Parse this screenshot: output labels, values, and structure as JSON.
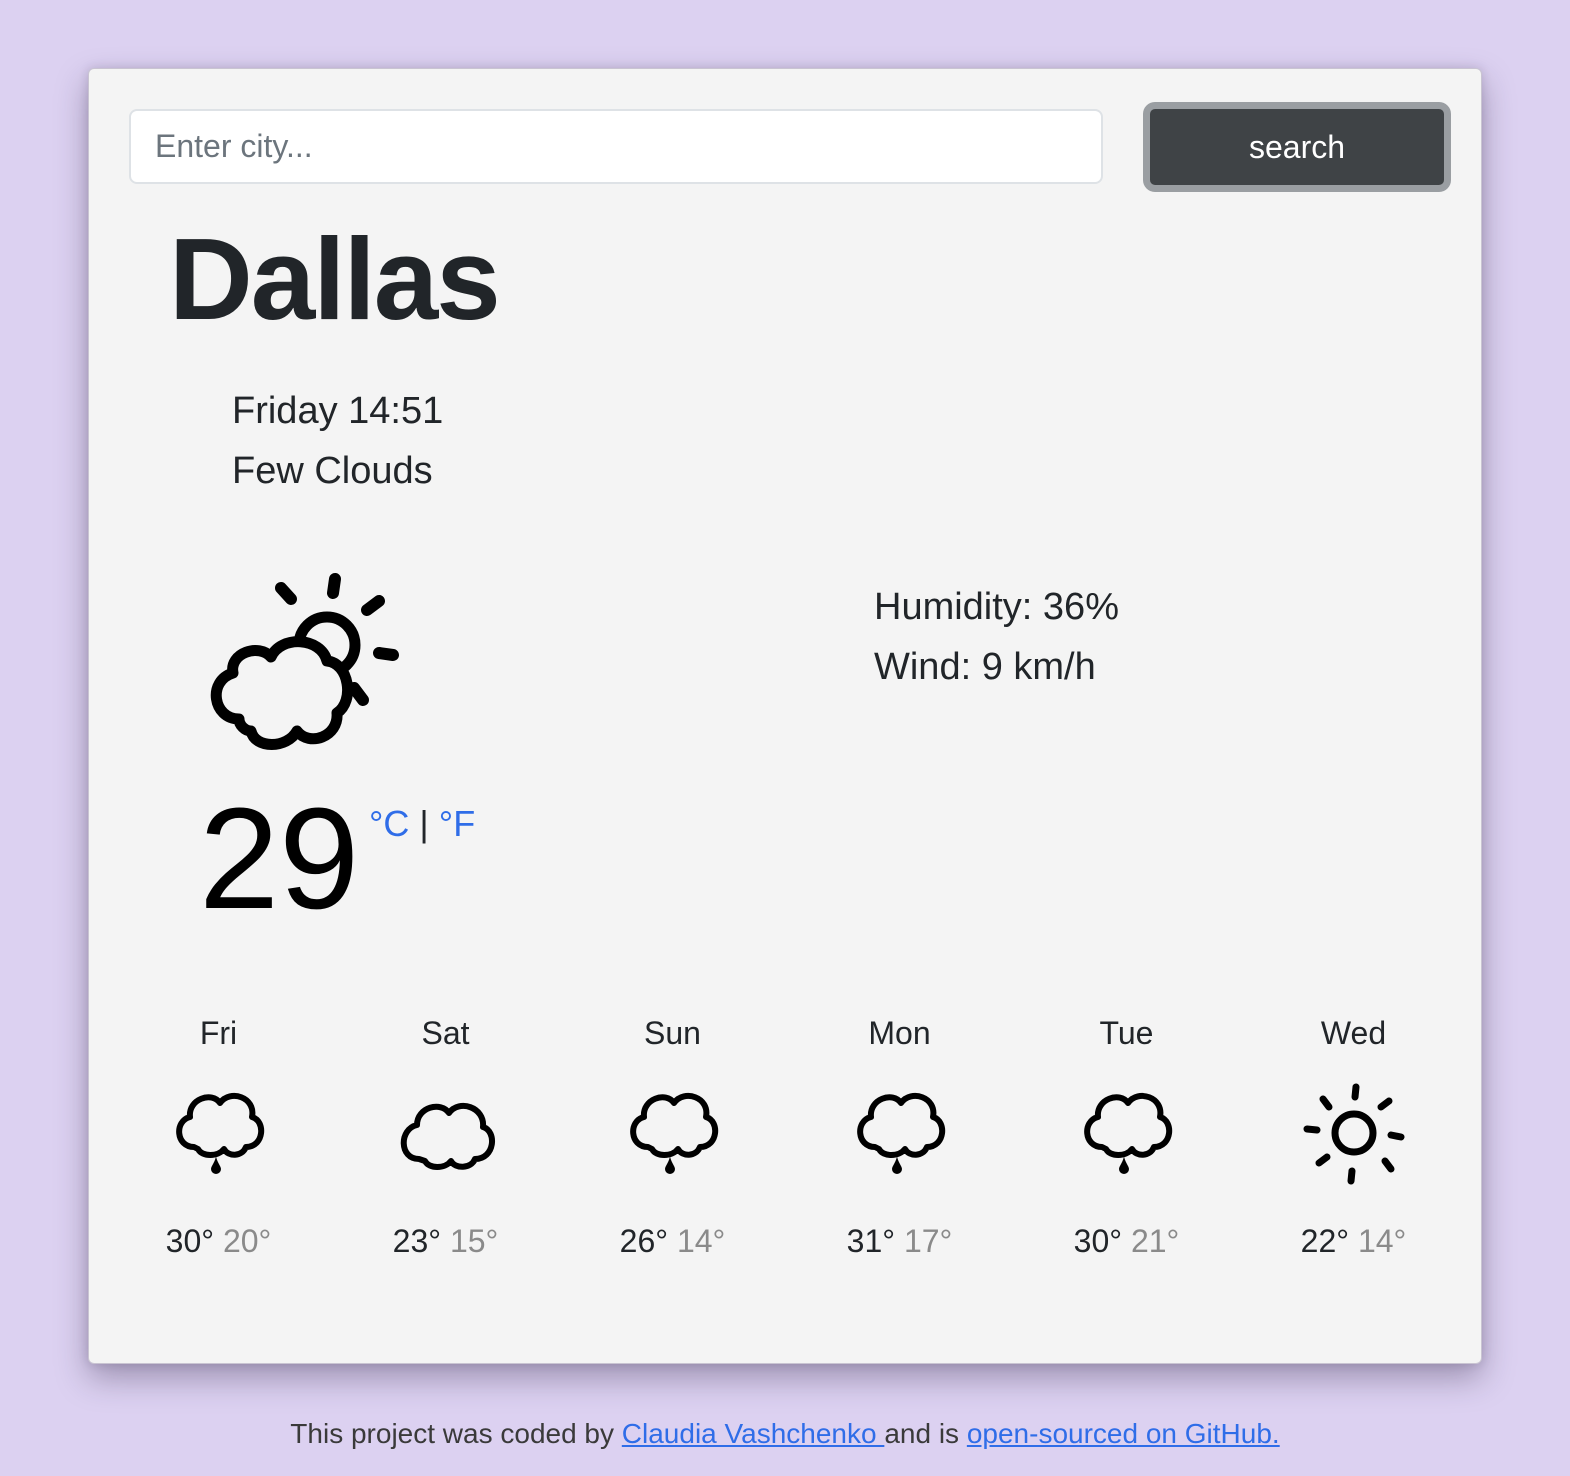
{
  "search": {
    "placeholder": "Enter city...",
    "button_label": "search"
  },
  "current": {
    "city": "Dallas",
    "datetime": "Friday 14:51",
    "description": "Few Clouds",
    "icon": "few-clouds-icon",
    "temperature": "29",
    "unit_celsius": "°C",
    "unit_separator": "|",
    "unit_fahrenheit": "°F",
    "humidity": "Humidity: 36%",
    "wind": "Wind: 9 km/h"
  },
  "forecast": [
    {
      "day": "Fri",
      "icon": "rain-icon",
      "max": "30°",
      "min": "20°"
    },
    {
      "day": "Sat",
      "icon": "cloud-icon",
      "max": "23°",
      "min": "15°"
    },
    {
      "day": "Sun",
      "icon": "rain-icon",
      "max": "26°",
      "min": "14°"
    },
    {
      "day": "Mon",
      "icon": "rain-icon",
      "max": "31°",
      "min": "17°"
    },
    {
      "day": "Tue",
      "icon": "rain-icon",
      "max": "30°",
      "min": "21°"
    },
    {
      "day": "Wed",
      "icon": "sun-icon",
      "max": "22°",
      "min": "14°"
    }
  ],
  "footer": {
    "prefix": "This project was coded by ",
    "author": "Claudia Vashchenko ",
    "middle": "and is ",
    "repo_link": "open-sourced on GitHub."
  },
  "colors": {
    "background": "#dcd1f1",
    "card": "#f4f4f4",
    "button": "#3f4346",
    "link": "#2f6de8"
  }
}
